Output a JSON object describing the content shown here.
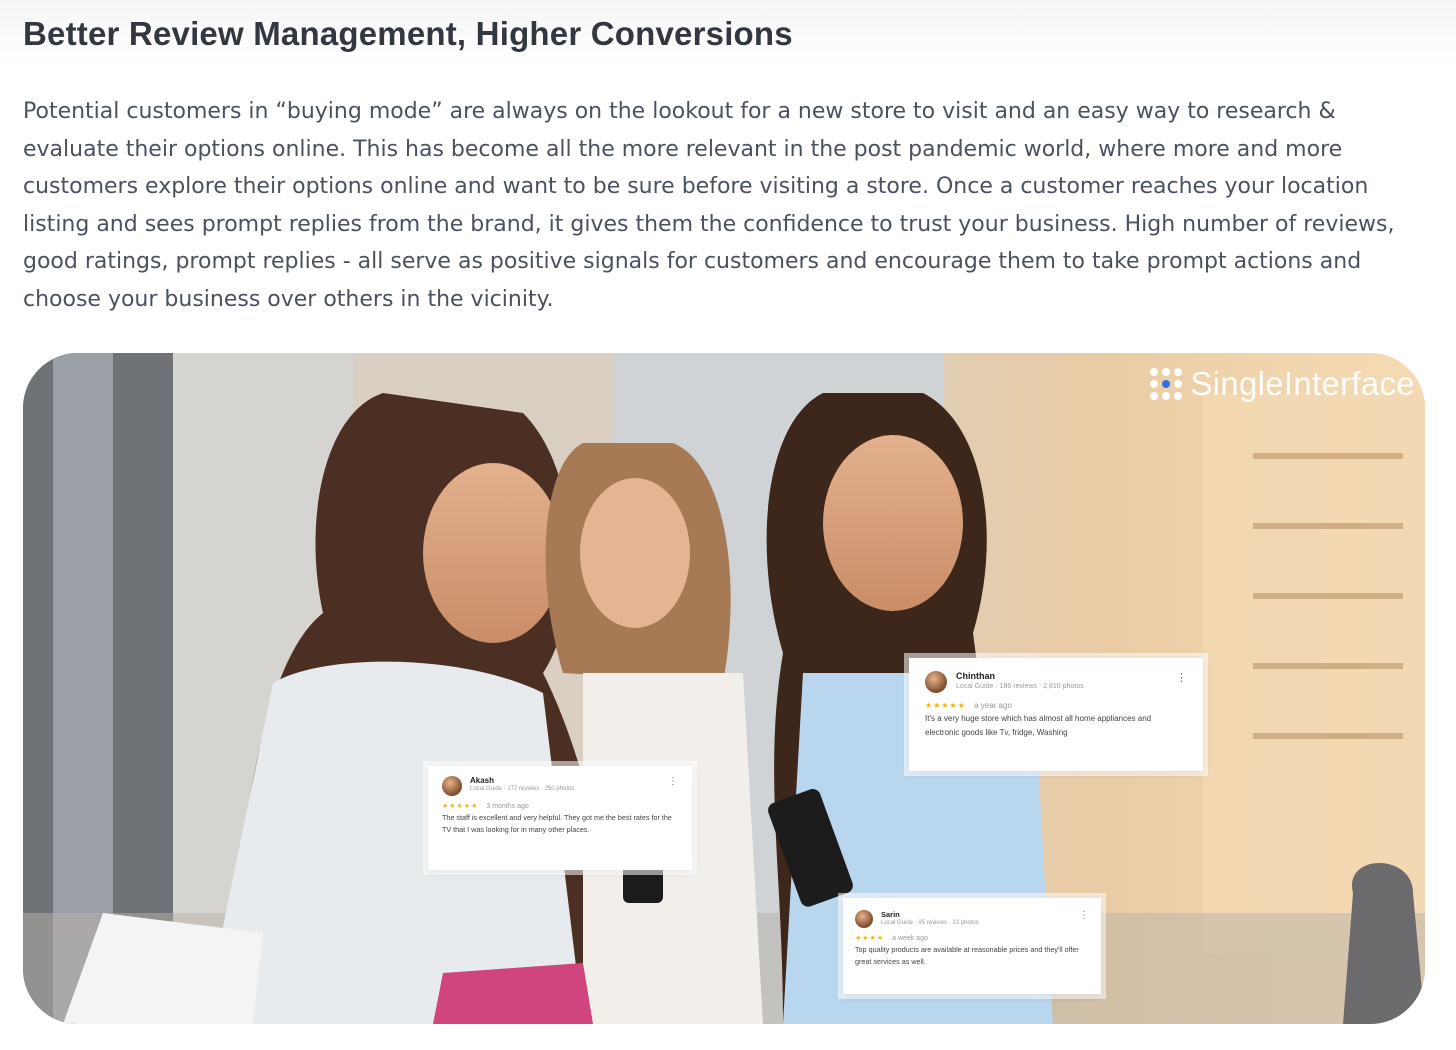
{
  "article": {
    "title": "Better Review Management, Higher Conversions",
    "paragraph": "Potential customers in “buying mode” are always on the lookout for a new store to visit and an easy way to research & evaluate their options online. This has become all the more relevant in the post pandemic world, where more and more customers explore their options online and want to be sure before visiting a store. Once a customer reaches your location listing and sees prompt replies from the brand, it gives them the confidence to trust your business. High number of reviews, good ratings, prompt replies - all serve as positive signals for customers and encourage them to take prompt actions and choose your business over others in the vicinity."
  },
  "hero": {
    "brand": "SingleInterface",
    "colors": {
      "brand_dot_accent": "#2f6fe0",
      "star": "#f5b400"
    },
    "reviews": [
      {
        "name": "Akash",
        "meta": "Local Guide · 177 reviews · 250 photos",
        "stars": "★★★★★",
        "when": "3 months ago",
        "text": "The staff is excellent and very helpful. They got me the best rates for the TV that I was looking for in many other places."
      },
      {
        "name": "Chinthan",
        "meta": "Local Guide · 186 reviews · 2,810 photos",
        "stars": "★★★★★",
        "when": "a year ago",
        "text": "It's a very huge store which has almost all home appliances and electronic goods like Tv, fridge, Washing"
      },
      {
        "name": "Sarin",
        "meta": "Local Guide · 95 reviews · 13 photos",
        "stars": "★★★★",
        "when": "a week ago",
        "text": "Top quality products are available at reasonable prices and they'll offer great services as well."
      }
    ]
  }
}
